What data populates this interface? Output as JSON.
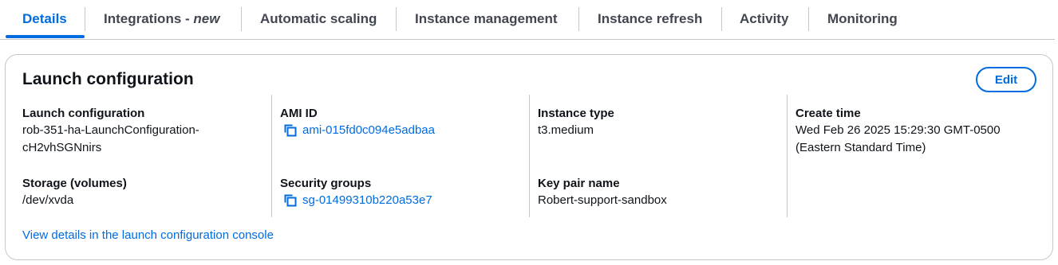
{
  "tabs": [
    {
      "label": "Details"
    },
    {
      "label": "Integrations - ",
      "label_italic": "new"
    },
    {
      "label": "Automatic scaling"
    },
    {
      "label": "Instance management"
    },
    {
      "label": "Instance refresh"
    },
    {
      "label": "Activity"
    },
    {
      "label": "Monitoring"
    }
  ],
  "card": {
    "title": "Launch configuration",
    "edit_label": "Edit",
    "launch_configuration": {
      "label": "Launch configuration",
      "value_line1": "rob-351-ha-LaunchConfiguration-",
      "value_line2": "cH2vhSGNnirs"
    },
    "storage": {
      "label": "Storage (volumes)",
      "value": "/dev/xvda"
    },
    "ami": {
      "label": "AMI ID",
      "value": "ami-015fd0c094e5adbaa"
    },
    "security_groups": {
      "label": "Security groups",
      "value": "sg-01499310b220a53e7"
    },
    "instance_type": {
      "label": "Instance type",
      "value": "t3.medium"
    },
    "key_pair": {
      "label": "Key pair name",
      "value": "Robert-support-sandbox"
    },
    "create_time": {
      "label": "Create time",
      "value_line1": "Wed Feb 26 2025 15:29:30 GMT-0500",
      "value_line2": "(Eastern Standard Time)"
    },
    "footer_link": "View details in the launch configuration console"
  },
  "colors": {
    "accent": "#006ce0",
    "text": "#0f141a",
    "tab_text": "#424650",
    "border": "#c6c6cd"
  },
  "icons": {
    "copy": "copy-icon"
  }
}
